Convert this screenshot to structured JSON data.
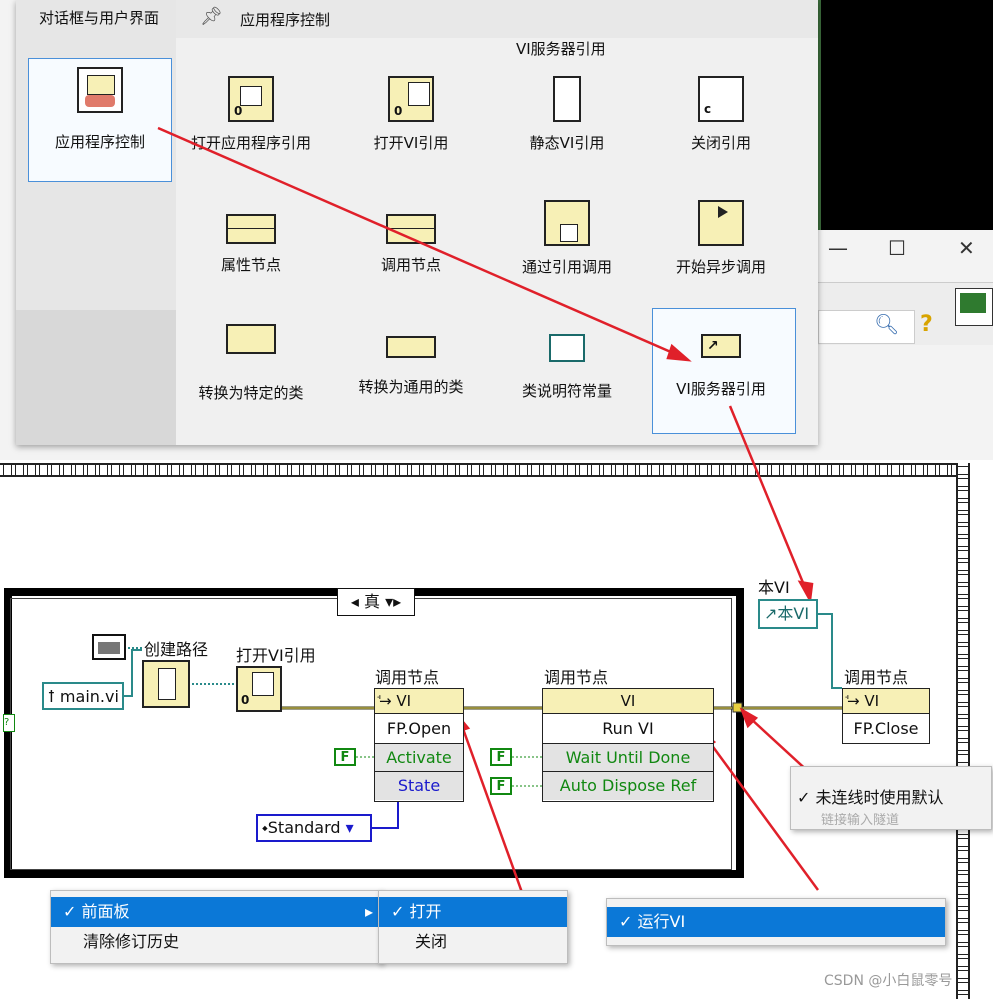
{
  "palette": {
    "category_label": "对话框与用户界面",
    "selected_category_label": "应用程序控制",
    "header_title": "应用程序控制",
    "sub_title": "VI服务器引用",
    "icons": [
      {
        "label": "打开应用程序引用"
      },
      {
        "label": "打开VI引用"
      },
      {
        "label": "静态VI引用"
      },
      {
        "label": "关闭引用"
      },
      {
        "label": "属性节点"
      },
      {
        "label": "调用节点"
      },
      {
        "label": "通过引用调用"
      },
      {
        "label": "开始异步调用"
      },
      {
        "label": "转换为特定的类"
      },
      {
        "label": "转换为通用的类"
      },
      {
        "label": "类说明符常量"
      },
      {
        "label": "VI服务器引用"
      }
    ]
  },
  "diagram": {
    "case_selector": "真",
    "path_const": "main.vi",
    "build_path_label": "创建路径",
    "open_vi_ref_label": "打开VI引用",
    "invoke1": {
      "label": "调用节点",
      "class": "VI",
      "method": "FP.Open",
      "params": [
        "Activate",
        "State"
      ]
    },
    "invoke2": {
      "label": "调用节点",
      "class": "VI",
      "method": "Run VI",
      "params": [
        "Wait Until Done",
        "Auto Dispose Ref"
      ]
    },
    "invoke3": {
      "label": "调用节点",
      "class": "VI",
      "method": "FP.Close"
    },
    "bool_const": "F",
    "enum_value": "Standard",
    "this_vi_label": "本VI",
    "this_vi_const": "本VI"
  },
  "menus": {
    "front_panel": {
      "item1": "前面板",
      "item2": "清除修订历史",
      "sub_open": "打开",
      "sub_close": "关闭"
    },
    "run_vi": {
      "item": "运行VI"
    },
    "tunnel": {
      "item": "未连线时使用默认",
      "item2": "链接输入隧道"
    }
  },
  "check_mark": "✓",
  "watermark": "CSDN @小白鼠零号",
  "colors": {
    "highlight": "#0b78d7",
    "arrow": "#e0202a",
    "icon_fill": "#f7f0b6",
    "bool_green": "#118811",
    "enum_blue": "#1a1acc",
    "ref_teal": "#2a8a8a"
  }
}
